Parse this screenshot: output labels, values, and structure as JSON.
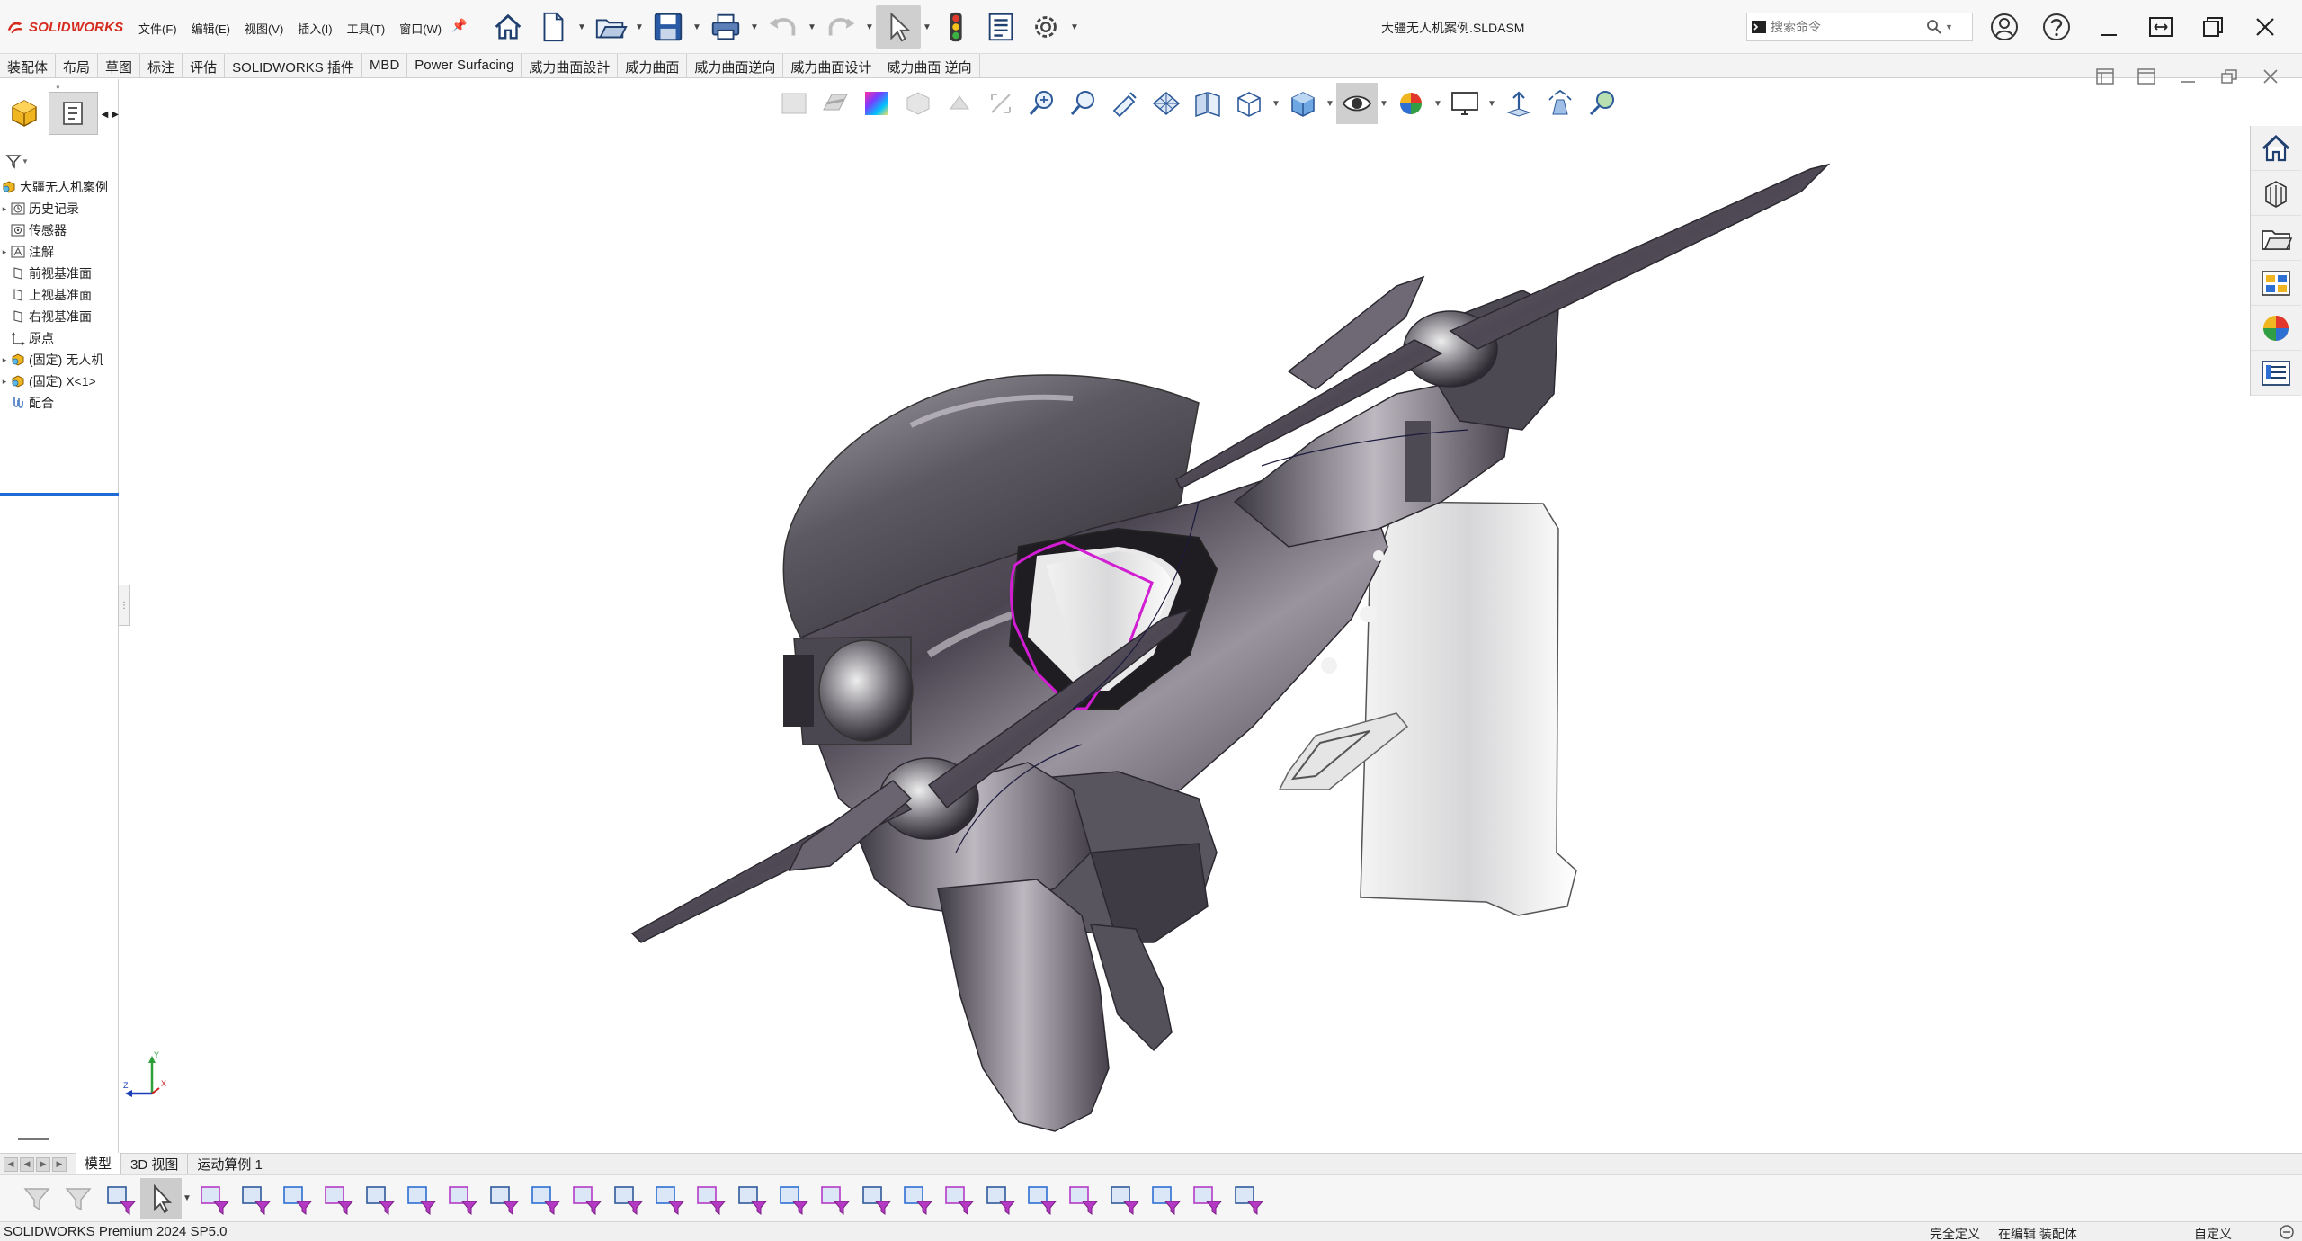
{
  "app": {
    "brand": "SOLIDWORKS",
    "document_title": "大疆无人机案例.SLDASM"
  },
  "menus": [
    {
      "label": "文件(F)"
    },
    {
      "label": "编辑(E)"
    },
    {
      "label": "视图(V)"
    },
    {
      "label": "插入(I)"
    },
    {
      "label": "工具(T)"
    },
    {
      "label": "窗口(W)"
    }
  ],
  "quick_access": [
    {
      "icon": "home-icon"
    },
    {
      "icon": "new-document-icon"
    },
    {
      "icon": "open-folder-icon"
    },
    {
      "icon": "save-icon"
    },
    {
      "icon": "print-icon"
    },
    {
      "icon": "undo-icon"
    },
    {
      "icon": "redo-icon"
    },
    {
      "icon": "select-pointer-icon"
    },
    {
      "icon": "rebuild-traffic-light-icon"
    },
    {
      "icon": "file-properties-icon"
    },
    {
      "icon": "options-gear-icon"
    }
  ],
  "search": {
    "placeholder": "搜索命令"
  },
  "command_tabs": [
    {
      "label": "装配体"
    },
    {
      "label": "布局"
    },
    {
      "label": "草图"
    },
    {
      "label": "标注"
    },
    {
      "label": "评估"
    },
    {
      "label": "SOLIDWORKS 插件"
    },
    {
      "label": "MBD"
    },
    {
      "label": "Power Surfacing"
    },
    {
      "label": "威力曲面設計"
    },
    {
      "label": "威力曲面"
    },
    {
      "label": "威力曲面逆向"
    },
    {
      "label": "威力曲面设计"
    },
    {
      "label": "威力曲面 逆向"
    }
  ],
  "feature_tree": {
    "root": "大疆无人机案例",
    "items": [
      {
        "label": "历史记录",
        "icon": "history-icon",
        "expandable": true
      },
      {
        "label": "传感器",
        "icon": "sensor-icon",
        "expandable": false
      },
      {
        "label": "注解",
        "icon": "annotation-icon",
        "expandable": true
      },
      {
        "label": "前视基准面",
        "icon": "plane-icon",
        "expandable": false
      },
      {
        "label": "上视基准面",
        "icon": "plane-icon",
        "expandable": false
      },
      {
        "label": "右视基准面",
        "icon": "plane-icon",
        "expandable": false
      },
      {
        "label": "原点",
        "icon": "origin-icon",
        "expandable": false
      },
      {
        "label": "(固定) 无人机",
        "icon": "part-icon",
        "expandable": true
      },
      {
        "label": "(固定) X<1>",
        "icon": "part-icon",
        "expandable": true
      },
      {
        "label": "配合",
        "icon": "mates-icon",
        "expandable": false
      }
    ]
  },
  "hud_toolbar": [
    {
      "icon": "previous-view-icon"
    },
    {
      "icon": "section-view-icon"
    },
    {
      "icon": "appearance-palette-icon"
    },
    {
      "icon": "hide-show-icon"
    },
    {
      "icon": "move-component-icon"
    },
    {
      "icon": "zoom-to-fit-icon"
    },
    {
      "icon": "zoom-in-icon"
    },
    {
      "icon": "zoom-area-icon"
    },
    {
      "icon": "pan-tool-icon"
    },
    {
      "icon": "mesh-display-icon"
    },
    {
      "icon": "split-views-icon"
    },
    {
      "icon": "view-orientation-icon"
    },
    {
      "icon": "display-style-cube-icon"
    },
    {
      "icon": "hide-show-items-eye-icon"
    },
    {
      "icon": "edit-appearance-icon"
    },
    {
      "icon": "scene-monitor-icon"
    },
    {
      "icon": "view-settings-icon"
    },
    {
      "icon": "rendering-tools-icon"
    },
    {
      "icon": "realview-icon"
    }
  ],
  "task_pane": [
    {
      "icon": "solidworks-resources-home-icon"
    },
    {
      "icon": "design-library-icon"
    },
    {
      "icon": "file-explorer-icon"
    },
    {
      "icon": "view-palette-icon"
    },
    {
      "icon": "appearances-scenes-icon"
    },
    {
      "icon": "custom-properties-icon"
    }
  ],
  "triad": {
    "x": "X",
    "y": "Y",
    "z": "Z"
  },
  "bottom_tabs": [
    {
      "label": "模型",
      "active": true
    },
    {
      "label": "3D 视图",
      "active": false
    },
    {
      "label": "运动算例 1",
      "active": false
    }
  ],
  "selection_filters": [
    {
      "icon": "toggle-filter-icon"
    },
    {
      "icon": "filter-off-icon"
    },
    {
      "icon": "clear-filters-icon"
    },
    {
      "icon": "select-pointer-icon"
    },
    {
      "icon": "select-other-icon"
    },
    {
      "icon": "filter-vertices-icon"
    },
    {
      "icon": "filter-edges-icon"
    },
    {
      "icon": "filter-faces-icon"
    },
    {
      "icon": "filter-surface-bodies-icon"
    },
    {
      "icon": "filter-solid-bodies-icon"
    },
    {
      "icon": "filter-axes-icon"
    },
    {
      "icon": "filter-planes-icon"
    },
    {
      "icon": "filter-points-icon"
    },
    {
      "icon": "filter-sketch-segments-icon"
    },
    {
      "icon": "filter-sketch-points-icon"
    },
    {
      "icon": "filter-centermarks-icon"
    },
    {
      "icon": "filter-dimensions-icon"
    },
    {
      "icon": "filter-surface-finish-icon"
    },
    {
      "icon": "filter-geometric-tolerance-icon"
    },
    {
      "icon": "filter-notes-icon"
    },
    {
      "icon": "filter-weld-symbols-icon"
    },
    {
      "icon": "filter-datum-targets-icon"
    },
    {
      "icon": "filter-cosmetic-threads-icon"
    },
    {
      "icon": "filter-blocks-icon"
    },
    {
      "icon": "filter-dowel-pin-icon"
    },
    {
      "icon": "filter-connection-points-icon"
    },
    {
      "icon": "filter-routing-points-icon"
    },
    {
      "icon": "filter-mid-points-icon"
    },
    {
      "icon": "filter-cosmetic-weld-icon"
    },
    {
      "icon": "filter-tables-icon"
    }
  ],
  "status_bar": {
    "product": "SOLIDWORKS Premium 2024 SP5.0",
    "definition": "完全定义",
    "editing": "在编辑 装配体",
    "units": "自定义"
  }
}
